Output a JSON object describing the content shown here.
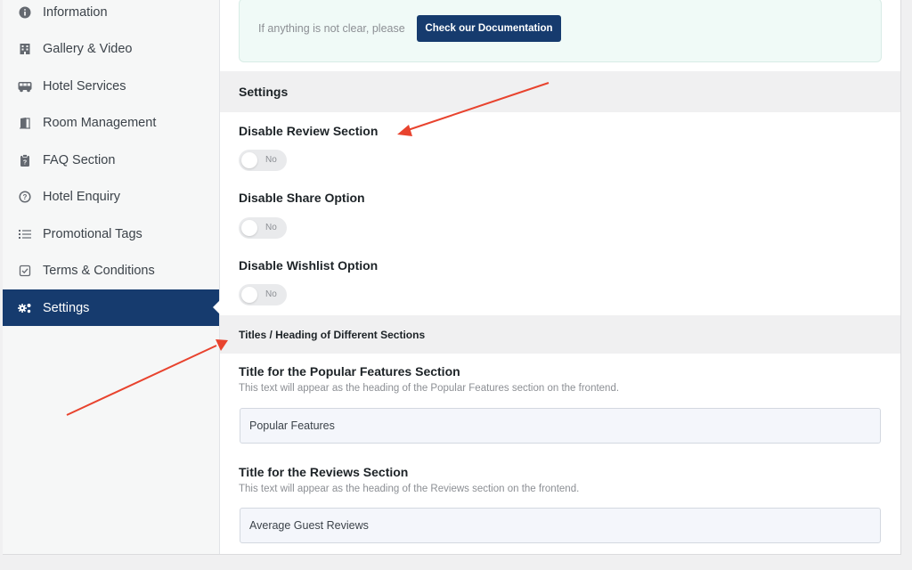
{
  "sidebar": {
    "items": [
      {
        "label": "Information",
        "icon": "info-icon"
      },
      {
        "label": "Gallery & Video",
        "icon": "building-icon"
      },
      {
        "label": "Hotel Services",
        "icon": "bus-icon"
      },
      {
        "label": "Room Management",
        "icon": "door-icon"
      },
      {
        "label": "FAQ Section",
        "icon": "clipboard-icon"
      },
      {
        "label": "Hotel Enquiry",
        "icon": "question-circle-icon"
      },
      {
        "label": "Promotional Tags",
        "icon": "list-icon"
      },
      {
        "label": "Terms & Conditions",
        "icon": "checkbox-icon"
      },
      {
        "label": "Settings",
        "icon": "gears-icon"
      }
    ],
    "active": "Settings"
  },
  "notice": {
    "text": "If anything is not clear, please",
    "button": "Check our Documentation"
  },
  "settings_section": {
    "title": "Settings",
    "toggles": [
      {
        "label": "Disable Review Section",
        "state": "No"
      },
      {
        "label": "Disable Share Option",
        "state": "No"
      },
      {
        "label": "Disable Wishlist Option",
        "state": "No"
      }
    ]
  },
  "titles_section": {
    "title": "Titles / Heading of Different Sections",
    "fields": [
      {
        "label": "Title for the Popular Features Section",
        "description": "This text will appear as the heading of the Popular Features section on the frontend.",
        "value": "Popular Features"
      },
      {
        "label": "Title for the Reviews Section",
        "description": "This text will appear as the heading of the Reviews section on the frontend.",
        "value": "Average Guest Reviews"
      }
    ]
  },
  "colors": {
    "accent": "#163b6e",
    "annotation_arrow": "#e8432e"
  }
}
